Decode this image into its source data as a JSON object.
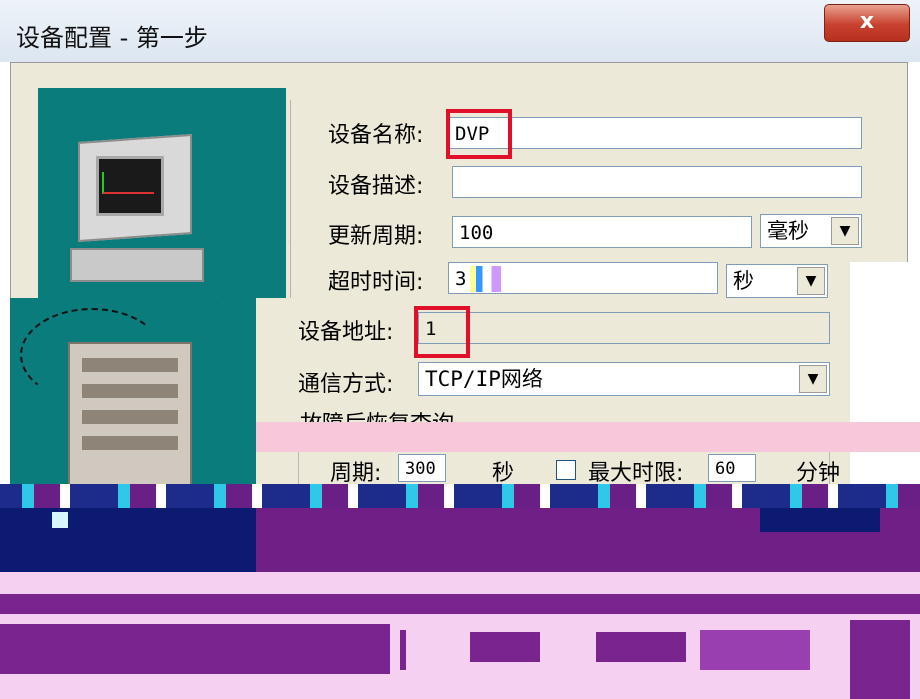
{
  "window": {
    "title": "设备配置 - 第一步",
    "close_glyph": "x"
  },
  "form": {
    "device_name_label": "设备名称:",
    "device_name_value": "DVP",
    "device_desc_label": "设备描述:",
    "device_desc_value": "",
    "update_period_label": "更新周期:",
    "update_period_value": "100",
    "update_period_unit": "毫秒",
    "timeout_label": "超时时间:",
    "timeout_value": "3",
    "timeout_unit": "秒",
    "address_label": "设备地址:",
    "address_value": "1",
    "comm_label": "通信方式:",
    "comm_value": "TCP/IP网络",
    "recovery_group_title": "故障后恢复查询",
    "period_label": "周期:",
    "period_value": "300",
    "period_unit": "秒",
    "max_limit_label": "最大时限:",
    "max_limit_value": "60",
    "max_limit_unit": "分钟",
    "dropdown_arrow": "▼"
  },
  "colors": {
    "illustration_bg": "#0b7c7c",
    "highlight_red": "#e0102a",
    "panel_bg": "#ece9d8",
    "glitch_purple": "#7a248f",
    "glitch_pink": "#f6d0f0",
    "glitch_navy": "#0c1a72"
  }
}
